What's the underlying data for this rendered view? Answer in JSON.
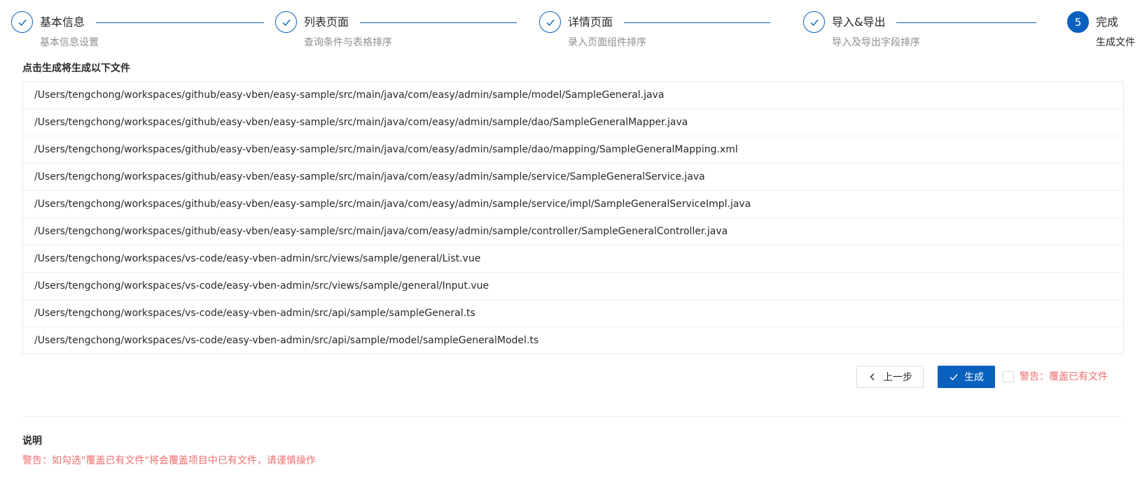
{
  "steps": [
    {
      "title": "基本信息",
      "description": "基本信息设置",
      "status": "finish"
    },
    {
      "title": "列表页面",
      "description": "查询条件与表格排序",
      "status": "finish"
    },
    {
      "title": "详情页面",
      "description": "录入页面组件排序",
      "status": "finish"
    },
    {
      "title": "导入&导出",
      "description": "导入及导出字段排序",
      "status": "finish"
    },
    {
      "title": "完成",
      "description": "生成文件",
      "status": "process",
      "number": "5"
    }
  ],
  "files": {
    "title": "点击生成将生成以下文件",
    "items": [
      "/Users/tengchong/workspaces/github/easy-vben/easy-sample/src/main/java/com/easy/admin/sample/model/SampleGeneral.java",
      "/Users/tengchong/workspaces/github/easy-vben/easy-sample/src/main/java/com/easy/admin/sample/dao/SampleGeneralMapper.java",
      "/Users/tengchong/workspaces/github/easy-vben/easy-sample/src/main/java/com/easy/admin/sample/dao/mapping/SampleGeneralMapping.xml",
      "/Users/tengchong/workspaces/github/easy-vben/easy-sample/src/main/java/com/easy/admin/sample/service/SampleGeneralService.java",
      "/Users/tengchong/workspaces/github/easy-vben/easy-sample/src/main/java/com/easy/admin/sample/service/impl/SampleGeneralServiceImpl.java",
      "/Users/tengchong/workspaces/github/easy-vben/easy-sample/src/main/java/com/easy/admin/sample/controller/SampleGeneralController.java",
      "/Users/tengchong/workspaces/vs-code/easy-vben-admin/src/views/sample/general/List.vue",
      "/Users/tengchong/workspaces/vs-code/easy-vben-admin/src/views/sample/general/Input.vue",
      "/Users/tengchong/workspaces/vs-code/easy-vben-admin/src/api/sample/sampleGeneral.ts",
      "/Users/tengchong/workspaces/vs-code/easy-vben-admin/src/api/sample/model/sampleGeneralModel.ts"
    ]
  },
  "actions": {
    "prev_label": "上一步",
    "generate_label": "生成",
    "overwrite_label": "警告：覆盖已有文件",
    "overwrite_checked": false
  },
  "notes": {
    "title": "说明",
    "warning": "警告：如勾选\"覆盖已有文件\"将会覆盖项目中已有文件，请谨慎操作"
  },
  "colors": {
    "primary": "#0960bd",
    "warning_text": "#ed6f6f",
    "border": "#e8e8e8"
  },
  "icons": {
    "finished_step": "check-icon",
    "prev_button": "left-arrow-icon",
    "generate_button": "check-icon"
  }
}
